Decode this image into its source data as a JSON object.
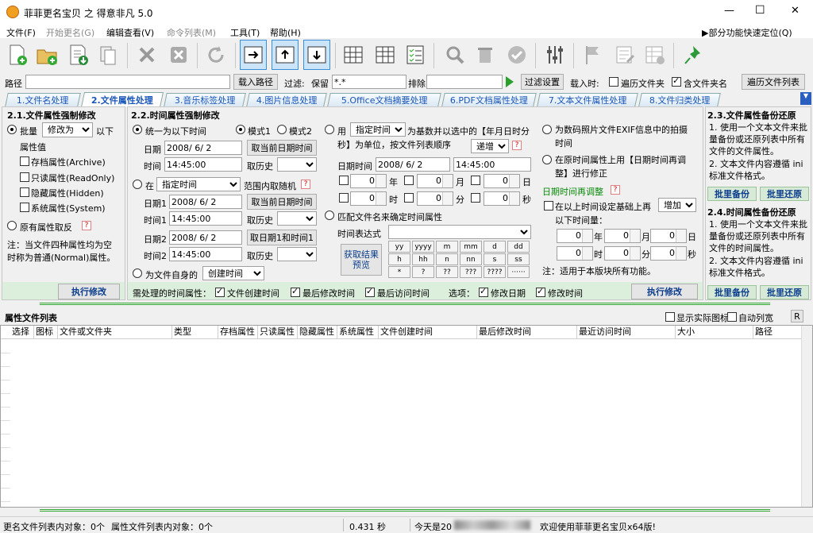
{
  "window": {
    "title": "菲菲更名宝贝 之 得意非凡 5.0",
    "min": "—",
    "max": "☐",
    "close": "✕"
  },
  "menu": {
    "items": [
      "文件(F)",
      "开始更名(G)",
      "编辑查看(V)",
      "命令列表(M)",
      "工具(T)",
      "帮助(H)"
    ],
    "right": "▶部分功能快速定位(Q)"
  },
  "pathbar": {
    "path_label": "路径",
    "load_path": "载入路径",
    "filter_label": "过滤:",
    "keep_label": "保留",
    "keep_value": "*.*",
    "exclude_label": "排除",
    "filter_settings": "过滤设置",
    "load_when": "载入时:",
    "traverse_folder": "遍历文件夹",
    "include_folder_name": "含文件夹名",
    "traverse_list": "遍历文件列表"
  },
  "tabs": [
    "1.文件名处理",
    "2.文件属性处理",
    "3.音乐标签处理",
    "4.图片信息处理",
    "5.Office文档摘要处理",
    "6.PDF文档属性处理",
    "7.文本文件属性处理",
    "8.文件归类处理"
  ],
  "p21": {
    "title": "2.1.文件属性强制修改",
    "batch": "批量",
    "modify_as": "修改为",
    "below": "以下",
    "attr_values": "属性值",
    "archive": "存档属性(Archive)",
    "readonly": "只读属性(ReadOnly)",
    "hidden": "隐藏属性(Hidden)",
    "system": "系统属性(System)",
    "invert": "原有属性取反",
    "note": "注：当文件四种属性均为空时称为普通(Normal)属性。",
    "exec": "执行修改"
  },
  "p22": {
    "title": "2.2.时间属性强制修改",
    "unify": "统一为以下时间",
    "mode1": "模式1",
    "mode2": "模式2",
    "date_label": "日期",
    "date_val": "2008/ 6/ 2",
    "time_label": "时间",
    "time_val": "14:45:00",
    "take_cur_date": "取当前日期时间",
    "take_history": "取历史",
    "in_label": "在",
    "specified_time": "指定时间",
    "range_random": "范围内取随机",
    "date1": "日期1",
    "time1": "时间1",
    "date2": "日期2",
    "time2": "时间2",
    "take_date1_time1": "取日期1和时间1",
    "for_own": "为文件自身的",
    "created_time": "创建时间",
    "use": "用",
    "as_base": "为基数并以选中的【年月日时分秒】为单位，按文件列表顺序",
    "increase": "递增",
    "datetime_label": "日期时间",
    "year": "年",
    "month": "月",
    "day": "日",
    "hour": "时",
    "minute": "分",
    "second": "秒",
    "zero": "0",
    "match_name": "匹配文件名来确定时间属性",
    "time_expr": "时间表达式",
    "get_preview": "获取结果预览",
    "keys": [
      "yy",
      "yyyy",
      "m",
      "mm",
      "d",
      "dd",
      "h",
      "hh",
      "n",
      "nn",
      "s",
      "ss",
      "*",
      "?",
      "??",
      "???",
      "????",
      "······"
    ],
    "exif": "为数码照片文件EXIF信息中的拍摄时间",
    "on_original": "在原时间属性上用【日期时间再调整】进行修正",
    "readjust": "日期时间再调整",
    "set_on": "在以上时间设定基础上再",
    "add": "增加",
    "below_amount": "以下时间量：",
    "apply_note": "注：适用于本版块所有功能。",
    "need_attr": "需处理的时间属性：",
    "file_created": "文件创建时间",
    "last_modified": "最后修改时间",
    "last_access": "最后访问时间",
    "options": "选项：",
    "modify_date": "修改日期",
    "modify_time": "修改时间",
    "exec": "执行修改"
  },
  "p23": {
    "title": "2.3.文件属性备份还原",
    "l1": "1. 使用一个文本文件来批量备份或还原列表中所有文件的文件属性。",
    "l2": "2. 文本文件内容遵循 ini标准文件格式。",
    "backup": "批里备份",
    "restore": "批里还原"
  },
  "p24": {
    "title": "2.4.时间属性备份还原",
    "l1": "1. 使用一个文本文件来批量备份或还原列表中所有文件的时间属性。",
    "l2": "2. 文本文件内容遵循 ini标准文件格式。",
    "backup": "批里备份",
    "restore": "批里还原"
  },
  "list": {
    "title": "属性文件列表",
    "show_icon": "显示实际图标",
    "autowidth": "自动列宽",
    "r": "R",
    "columns": [
      "选择",
      "图标",
      "文件或文件夹",
      "类型",
      "存档属性",
      "只读属性",
      "隐藏属性",
      "系统属性",
      "文件创建时间",
      "最后修改时间",
      "最近访问时间",
      "大小",
      "路径"
    ]
  },
  "status": {
    "s1": "更名文件列表内对象：0个",
    "s2": "属性文件列表内对象：0个",
    "s3": "0.431 秒",
    "s4": "今天是20",
    "s5": "欢迎使用菲菲更名宝贝x64版!"
  }
}
